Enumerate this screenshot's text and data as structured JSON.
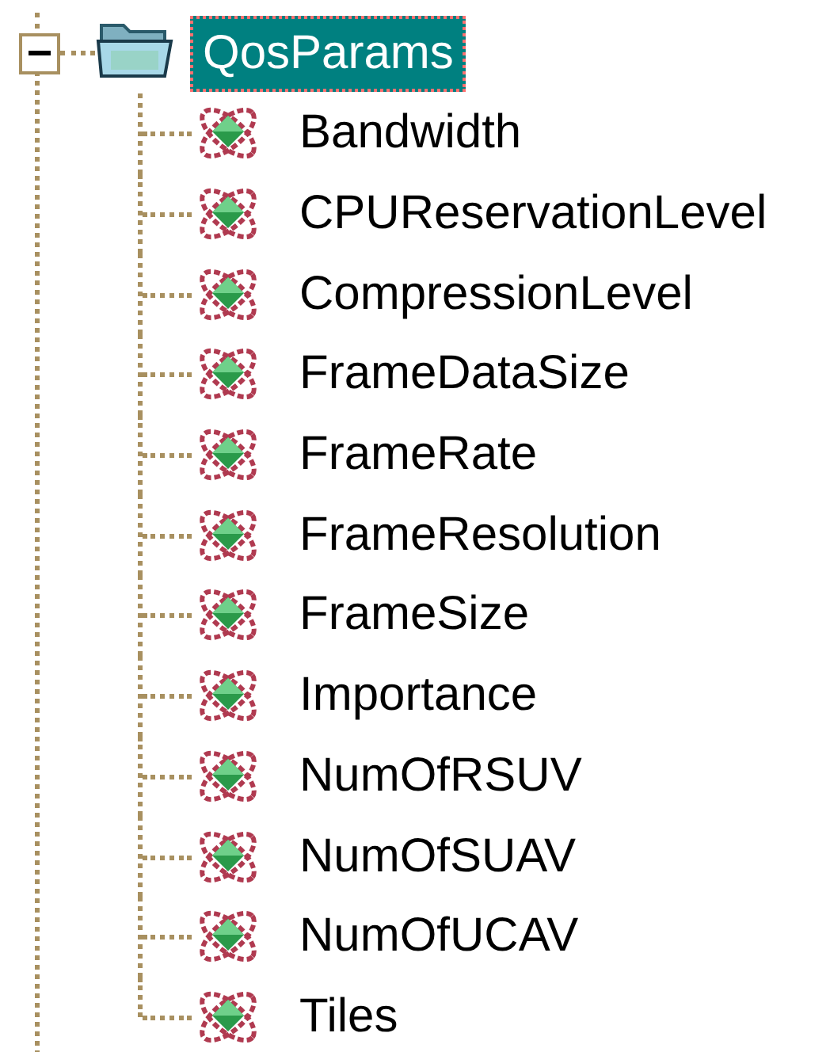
{
  "tree": {
    "label": "QosParams",
    "selected": true,
    "expanded": true,
    "children": [
      {
        "label": "Bandwidth",
        "selected": false
      },
      {
        "label": "CPUReservationLevel",
        "selected": false
      },
      {
        "label": "CompressionLevel",
        "selected": false
      },
      {
        "label": "FrameDataSize",
        "selected": false
      },
      {
        "label": "FrameRate",
        "selected": false
      },
      {
        "label": "FrameResolution",
        "selected": false
      },
      {
        "label": "FrameSize",
        "selected": false
      },
      {
        "label": "Importance",
        "selected": false
      },
      {
        "label": "NumOfRSUV",
        "selected": false
      },
      {
        "label": "NumOfSUAV",
        "selected": false
      },
      {
        "label": "NumOfUCAV",
        "selected": false
      },
      {
        "label": "Tiles",
        "selected": false
      }
    ]
  }
}
